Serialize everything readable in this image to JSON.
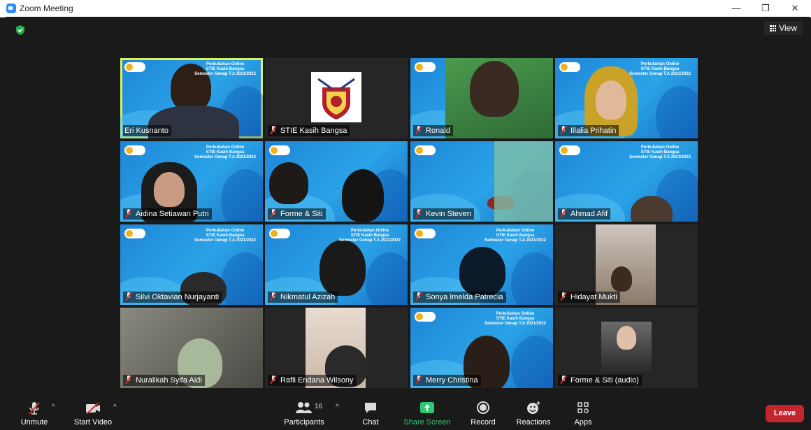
{
  "window": {
    "title": "Zoom Meeting",
    "minimize": "—",
    "maximize": "❐",
    "close": "✕"
  },
  "header": {
    "view_label": "View"
  },
  "participants": [
    {
      "name": "Eri Kusnanto",
      "muted": false,
      "active": true
    },
    {
      "name": "STIE Kasih Bangsa",
      "muted": true
    },
    {
      "name": "Ronald",
      "muted": true
    },
    {
      "name": "Illalia Prihatin",
      "muted": true
    },
    {
      "name": "Aidina Setiawan Putri",
      "muted": true
    },
    {
      "name": "Forme & Siti",
      "muted": true
    },
    {
      "name": "Kevin Steven",
      "muted": true
    },
    {
      "name": "Ahmad Afif",
      "muted": true
    },
    {
      "name": "Silvi Oktavian Nurjayanti",
      "muted": true
    },
    {
      "name": "Nikmatul Azizah",
      "muted": true
    },
    {
      "name": "Sonya Imelda Patrecia",
      "muted": true
    },
    {
      "name": "Hidayat Mukti",
      "muted": true
    },
    {
      "name": "Nuralikah Syifa Aidi",
      "muted": true
    },
    {
      "name": "Rafli Endana Wilsony",
      "muted": true
    },
    {
      "name": "Merry Christina",
      "muted": true
    },
    {
      "name": "Forme & Siti (audio)",
      "muted": true
    }
  ],
  "banner": {
    "line1": "Perkuliahan Online",
    "line2": "STIE Kasih Bangsa",
    "line3": "Semester Genap T.A 2021/2022"
  },
  "toolbar": {
    "unmute": "Unmute",
    "start_video": "Start Video",
    "participants": "Participants",
    "participant_count": "16",
    "chat": "Chat",
    "share_screen": "Share Screen",
    "record": "Record",
    "reactions": "Reactions",
    "apps": "Apps",
    "leave": "Leave"
  },
  "colors": {
    "active_border": "#d8f25a",
    "leave": "#c4262e",
    "share": "#2fc872",
    "mute_slash": "#e02828"
  }
}
